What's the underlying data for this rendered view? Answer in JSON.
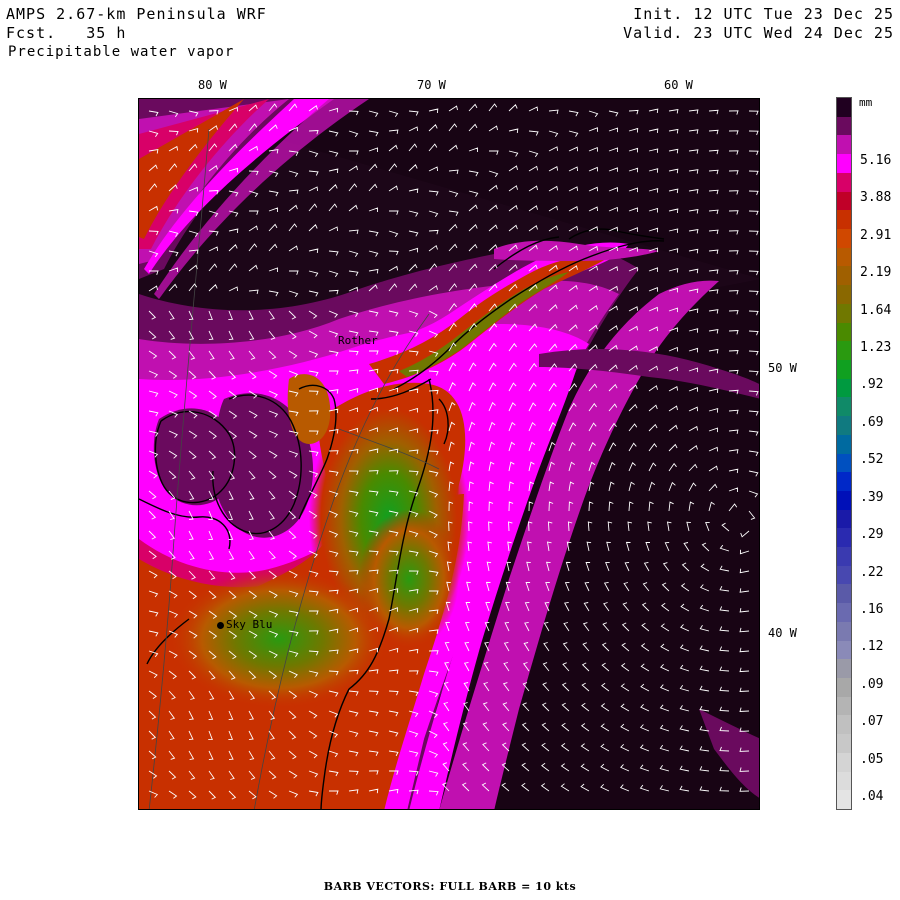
{
  "header": {
    "model_title": "AMPS 2.67-km Peninsula WRF",
    "forecast": "Fcst.   35 h",
    "field": "Precipitable water vapor",
    "init": "Init. 12 UTC Tue 23 Dec 25",
    "valid": "Valid. 23 UTC Wed 24 Dec 25"
  },
  "axes": {
    "lon_labels": [
      "80 W",
      "70 W",
      "60 W"
    ],
    "lat_labels": [
      "50 W",
      "40 W"
    ]
  },
  "stations": [
    {
      "name": "Rother",
      "marker": false
    },
    {
      "name": "Sky Blu",
      "marker": true
    }
  ],
  "colorbar": {
    "unit": "mm",
    "labels": [
      "5.16",
      "3.88",
      "2.91",
      "2.19",
      "1.64",
      "1.23",
      ".92",
      ".69",
      ".52",
      ".39",
      ".29",
      ".22",
      ".16",
      ".12",
      ".09",
      ".07",
      ".05",
      ".04"
    ],
    "colors": [
      "#200020",
      "#6a0a5e",
      "#c010b0",
      "#ff00ff",
      "#d80068",
      "#c00028",
      "#c83000",
      "#d04800",
      "#b85a00",
      "#a06000",
      "#8a6800",
      "#707800",
      "#4a8a00",
      "#2a9a10",
      "#10a020",
      "#009a40",
      "#108a68",
      "#107a80",
      "#006aa0",
      "#0050c0",
      "#0028c8",
      "#0010b8",
      "#1a1aa8",
      "#2a2ab0",
      "#3a3ab0",
      "#4848b0",
      "#5a5aa8",
      "#6a6ab0",
      "#7a7ab0",
      "#8a8ab8",
      "#9a9aa8",
      "#a8a8a8",
      "#b4b4b4",
      "#c0c0c0",
      "#c8c8c8",
      "#d4d4d4",
      "#dcdcdc",
      "#e4e4e4"
    ]
  },
  "footer": "BARB VECTORS:  FULL BARB = 10 kts"
}
